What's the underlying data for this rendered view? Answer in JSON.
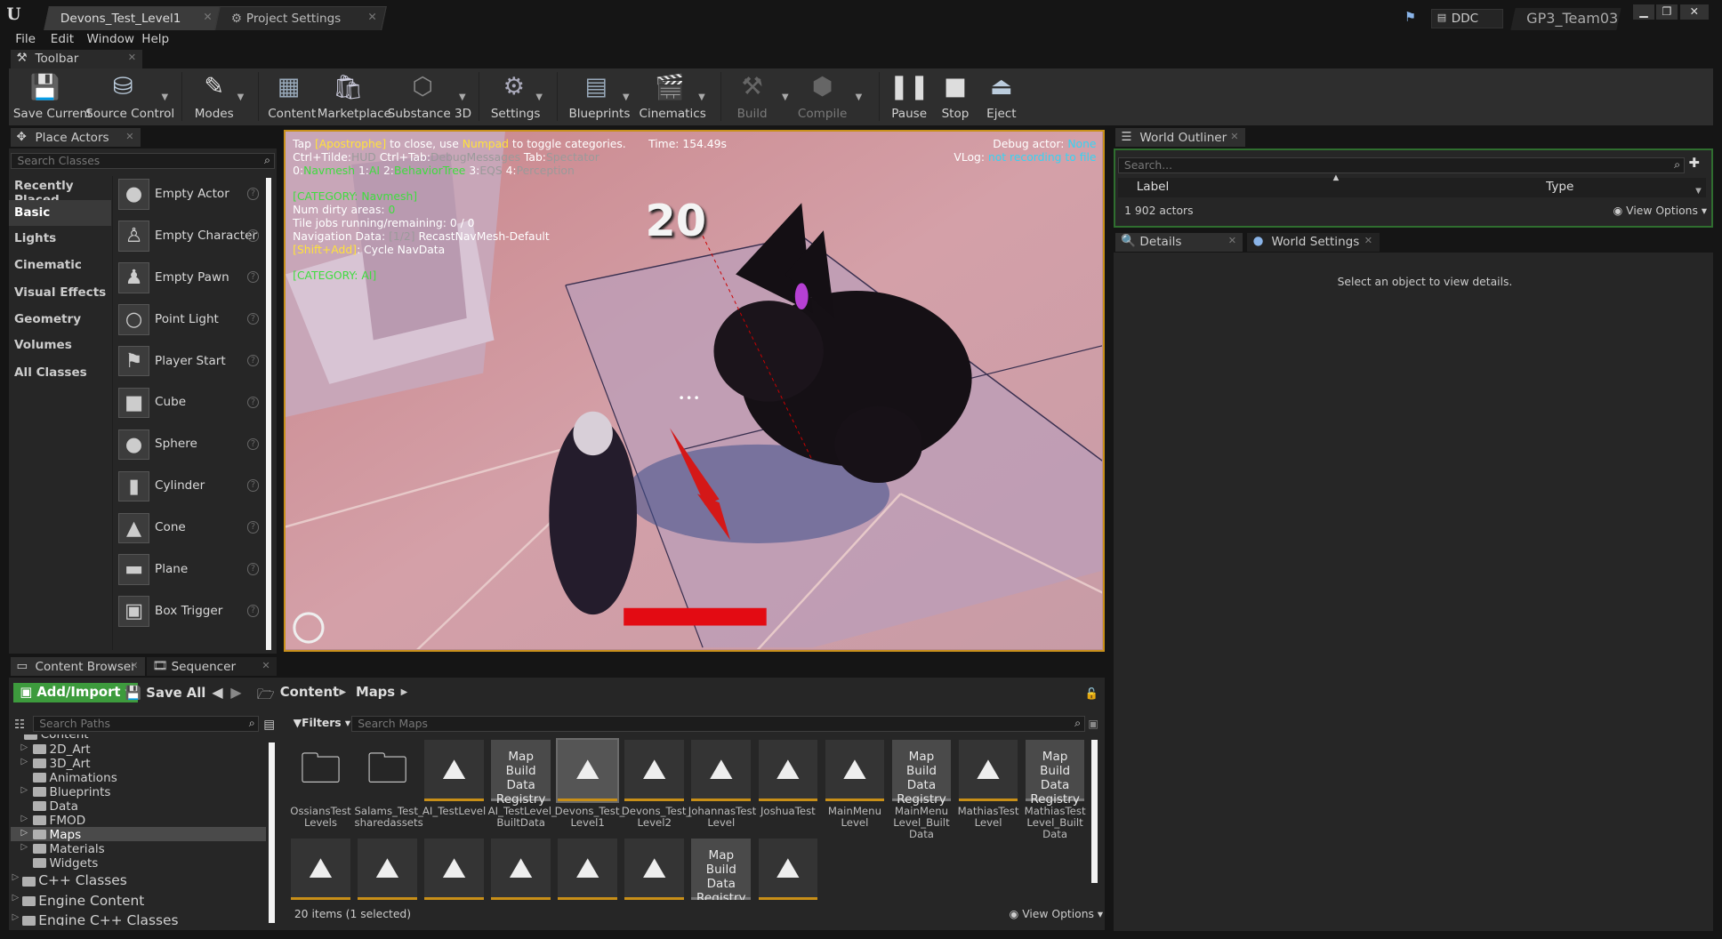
{
  "window": {
    "tabs": [
      {
        "label": "Devons_Test_Level1"
      },
      {
        "label": "Project Settings"
      }
    ],
    "ddc_label": "DDC",
    "project_name": "GP3_Team03",
    "controls": [
      "minimize",
      "restore",
      "close"
    ]
  },
  "menu": [
    "File",
    "Edit",
    "Window",
    "Help"
  ],
  "toolbar": {
    "tab_label": "Toolbar",
    "items": [
      {
        "label": "Save Current",
        "icon": "save-icon"
      },
      {
        "label": "Source Control",
        "icon": "source-control-icon"
      },
      {
        "label": "Modes",
        "icon": "modes-icon"
      },
      {
        "label": "Content",
        "icon": "content-icon"
      },
      {
        "label": "Marketplace",
        "icon": "marketplace-icon"
      },
      {
        "label": "Substance 3D",
        "icon": "substance-icon"
      },
      {
        "label": "Settings",
        "icon": "settings-icon"
      },
      {
        "label": "Blueprints",
        "icon": "blueprints-icon"
      },
      {
        "label": "Cinematics",
        "icon": "cinematics-icon"
      },
      {
        "label": "Build",
        "icon": "build-icon"
      },
      {
        "label": "Compile",
        "icon": "compile-icon"
      },
      {
        "label": "Pause",
        "icon": "pause-icon"
      },
      {
        "label": "Stop",
        "icon": "stop-icon"
      },
      {
        "label": "Eject",
        "icon": "eject-icon"
      }
    ]
  },
  "place_actors": {
    "tab_label": "Place Actors",
    "search_placeholder": "Search Classes",
    "categories": [
      "Recently Placed",
      "Basic",
      "Lights",
      "Cinematic",
      "Visual Effects",
      "Geometry",
      "Volumes",
      "All Classes"
    ],
    "active_category": "Basic",
    "actors": [
      "Empty Actor",
      "Empty Character",
      "Empty Pawn",
      "Point Light",
      "Player Start",
      "Cube",
      "Sphere",
      "Cylinder",
      "Cone",
      "Plane",
      "Box Trigger"
    ]
  },
  "viewport": {
    "line1_a": "Tap ",
    "line1_b": "[Apostrophe]",
    "line1_c": " to close, use ",
    "line1_d": "Numpad",
    "line1_e": " to toggle categories.",
    "time": "Time: 154.49s",
    "debug_actor_label": "Debug actor: ",
    "debug_actor_value": "None",
    "vlog_label": "VLog: ",
    "vlog_value": "not recording to file",
    "line2_a": "Ctrl+Tilde:",
    "line2_b": "HUD",
    "line2_c": "  Ctrl+Tab:",
    "line2_d": "DebugMessages",
    "line2_e": "  Tab:",
    "line2_f": "Spectator",
    "line3_a": "0:",
    "line3_b": "Navmesh",
    "line3_c": "  1:",
    "line3_d": "AI",
    "line3_e": "  2:",
    "line3_f": "BehaviorTree",
    "line3_g": "  3:",
    "line3_h": "EQS",
    "line3_i": "  4:",
    "line3_j": "Perception",
    "category_navmesh": "[CATEGORY: Navmesh]",
    "num_dirty_label": "Num dirty areas: ",
    "num_dirty_value": "0",
    "tile_jobs": "Tile jobs running/remaining: 0 / 0",
    "nav_data_a": "Navigation Data: ",
    "nav_data_b": "[1/2]",
    "nav_data_c": " RecastNavMesh-Default",
    "cycle_a": "[Shift+Add]",
    "cycle_b": ": Cycle NavData",
    "category_ai": "[CATEGORY: AI]",
    "counter": "20",
    "ellipsis": "•••"
  },
  "world_outliner": {
    "tab_label": "World Outliner",
    "search_placeholder": "Search...",
    "col_label": "Label",
    "col_type": "Type",
    "actor_count": "1 902 actors",
    "view_options": "View Options"
  },
  "details": {
    "tab_label": "Details",
    "tab2_label": "World Settings",
    "empty_message": "Select an object to view details."
  },
  "content_browser": {
    "tab_label": "Content Browser",
    "tab2_label": "Sequencer",
    "add_import": "Add/Import",
    "save_all": "Save All",
    "breadcrumb": [
      "Content",
      "Maps"
    ],
    "search_paths_placeholder": "Search Paths",
    "filters_label": "Filters",
    "search_maps_placeholder": "Search Maps",
    "tree": [
      {
        "label": "Content",
        "indent": 0
      },
      {
        "label": "2D_Art",
        "indent": 1
      },
      {
        "label": "3D_Art",
        "indent": 1
      },
      {
        "label": "Animations",
        "indent": 1
      },
      {
        "label": "Blueprints",
        "indent": 1
      },
      {
        "label": "Data",
        "indent": 1
      },
      {
        "label": "FMOD",
        "indent": 1
      },
      {
        "label": "Maps",
        "indent": 1
      },
      {
        "label": "Materials",
        "indent": 1
      },
      {
        "label": "Widgets",
        "indent": 1
      }
    ],
    "tree_roots": [
      "C++ Classes",
      "Engine Content",
      "Engine C++ Classes"
    ],
    "assets_row1": [
      {
        "name": "OssiansTest Levels",
        "kind": "folder"
      },
      {
        "name": "Salams_Test_ sharedassets",
        "kind": "folder"
      },
      {
        "name": "AI_TestLevel",
        "kind": "map"
      },
      {
        "name": "AI_TestLevel_ BuiltData",
        "kind": "mbdr",
        "label": "Map Build Data Registry"
      },
      {
        "name": "Devons_Test_ Level1",
        "kind": "map"
      },
      {
        "name": "Devons_Test_ Level2",
        "kind": "map"
      },
      {
        "name": "JohannasTest Level",
        "kind": "map"
      },
      {
        "name": "JoshuaTest",
        "kind": "map"
      },
      {
        "name": "MainMenu Level",
        "kind": "map"
      },
      {
        "name": "MainMenu Level_Built Data",
        "kind": "mbdr",
        "label": "Map Build Data Registry"
      },
      {
        "name": "MathiasTest Level",
        "kind": "map"
      },
      {
        "name": "MathiasTest Level_Built Data",
        "kind": "mbdr",
        "label": "Map Build Data Registry"
      }
    ],
    "row2_mbdr_label": "Map Build Data Registry",
    "status": "20 items (1 selected)",
    "view_options": "View Options"
  }
}
